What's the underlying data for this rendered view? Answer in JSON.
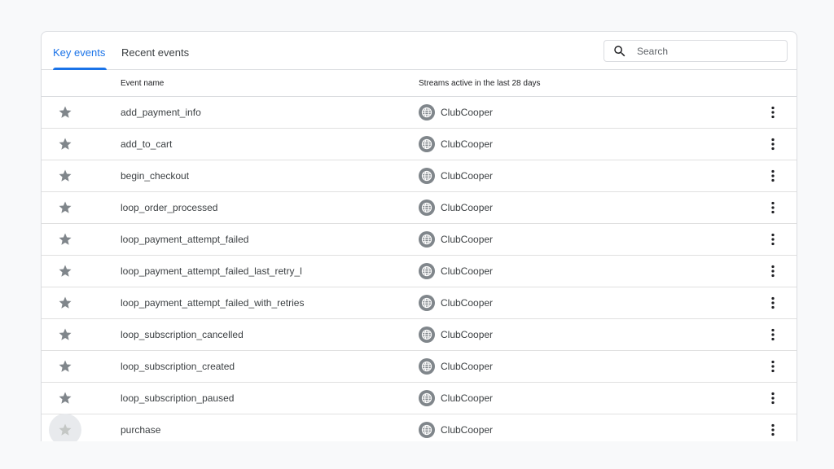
{
  "tabs": {
    "key_events": "Key events",
    "recent_events": "Recent events"
  },
  "search": {
    "placeholder": "Search",
    "value": ""
  },
  "table": {
    "headers": {
      "event_name": "Event name",
      "streams": "Streams active in the last 28 days"
    },
    "rows": [
      {
        "name": "add_payment_info",
        "stream": "ClubCooper"
      },
      {
        "name": "add_to_cart",
        "stream": "ClubCooper"
      },
      {
        "name": "begin_checkout",
        "stream": "ClubCooper"
      },
      {
        "name": "loop_order_processed",
        "stream": "ClubCooper"
      },
      {
        "name": "loop_payment_attempt_failed",
        "stream": "ClubCooper"
      },
      {
        "name": "loop_payment_attempt_failed_last_retry_l",
        "stream": "ClubCooper"
      },
      {
        "name": "loop_payment_attempt_failed_with_retries",
        "stream": "ClubCooper"
      },
      {
        "name": "loop_subscription_cancelled",
        "stream": "ClubCooper"
      },
      {
        "name": "loop_subscription_created",
        "stream": "ClubCooper"
      },
      {
        "name": "loop_subscription_paused",
        "stream": "ClubCooper"
      },
      {
        "name": "purchase",
        "stream": "ClubCooper"
      }
    ]
  },
  "icons": {
    "star": "star-icon",
    "globe": "globe-icon",
    "more": "more-vert-icon",
    "search": "search-icon"
  },
  "colors": {
    "accent": "#1a73e8",
    "star": "#80868b",
    "star_muted": "#c4c7c5",
    "globe": "#80868b",
    "border": "#dadce0"
  }
}
